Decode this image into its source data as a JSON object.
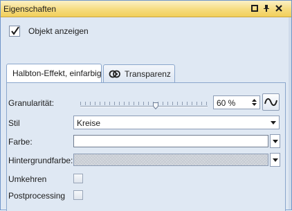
{
  "window": {
    "title": "Eigenschaften",
    "icons": [
      "window-position-icon",
      "pin-icon",
      "close-icon"
    ]
  },
  "show_object": {
    "label": "Objekt anzeigen",
    "checked": true
  },
  "tabs": [
    {
      "label": "Halbton-Effekt, einfarbig",
      "active": true
    },
    {
      "label": "Transparenz",
      "active": false,
      "icon": "transparency-icon"
    }
  ],
  "panel": {
    "granularity": {
      "label": "Granularität:",
      "value": "60 %",
      "slider_fraction": 0.6
    },
    "style": {
      "label": "Stil",
      "value": "Kreise"
    },
    "color": {
      "label": "Farbe:",
      "value_color": "#ffffff"
    },
    "background": {
      "label": "Hintergrundfarbe:"
    },
    "invert": {
      "label": "Umkehren",
      "checked": false
    },
    "postprocessing": {
      "label": "Postprocessing",
      "checked": false
    }
  },
  "colors": {
    "title_bar": "#f6dc7f",
    "panel_bg": "#dfe8f3",
    "border": "#8aa6cc"
  }
}
